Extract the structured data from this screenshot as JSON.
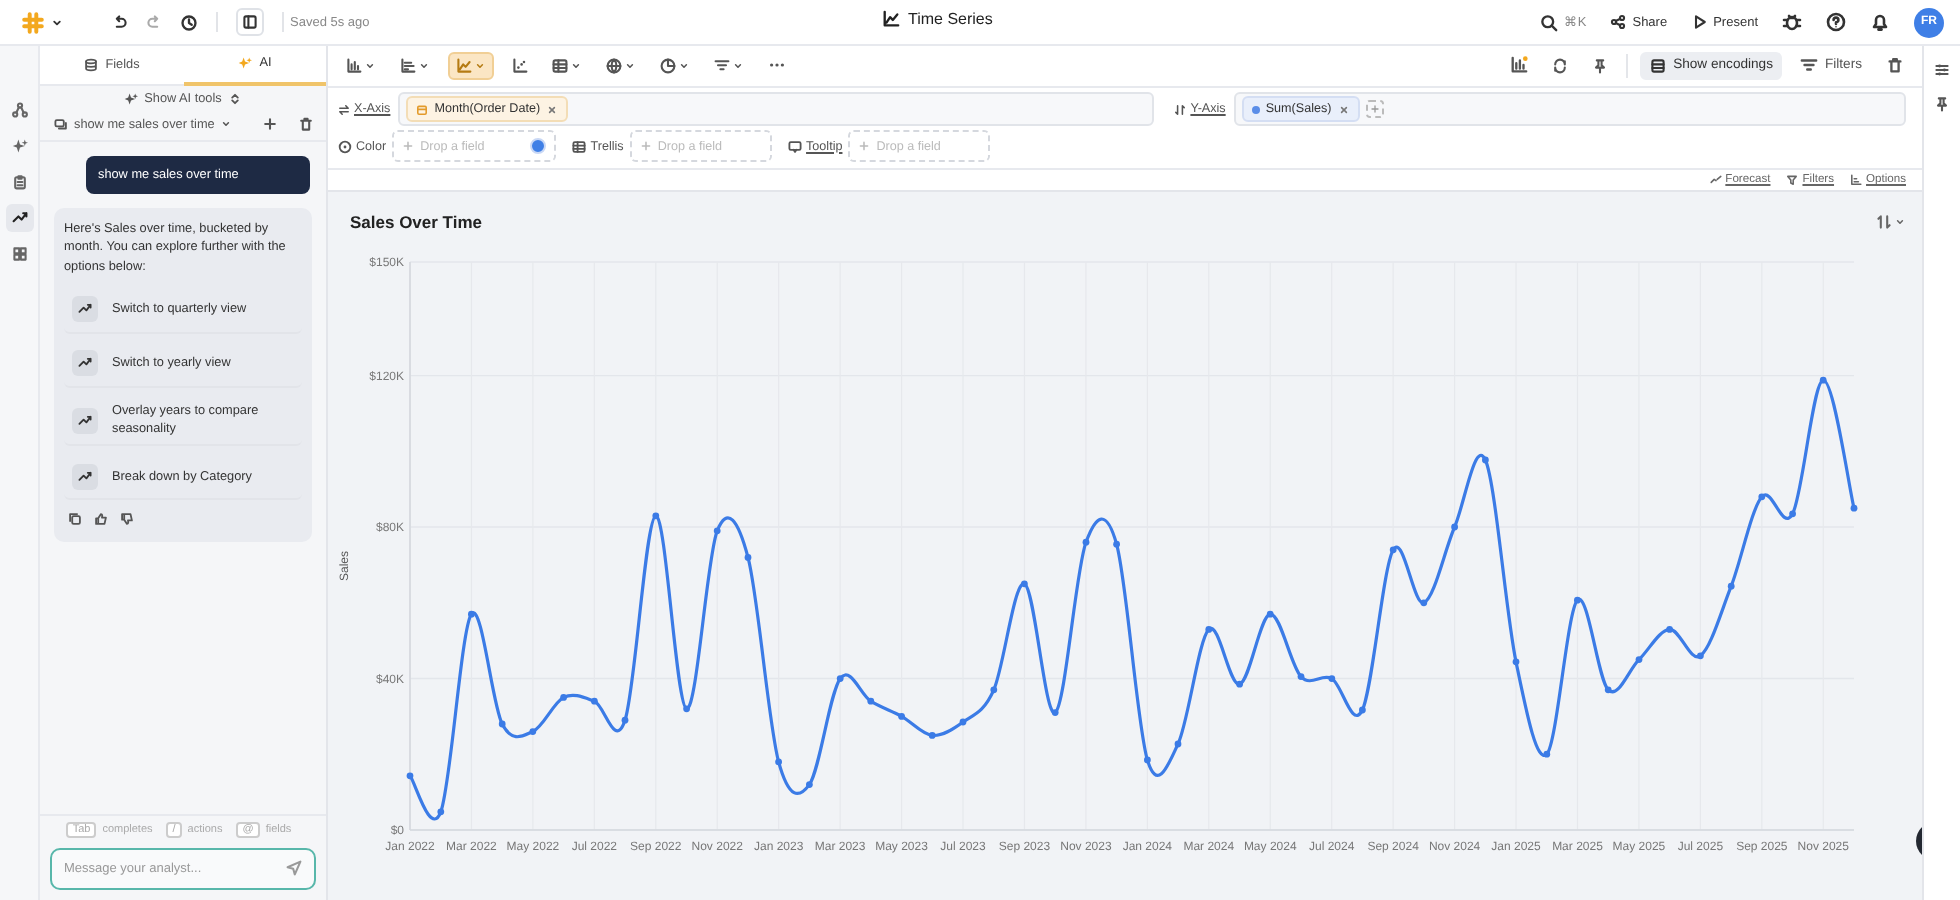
{
  "app": {
    "saved_status": "Saved 5s ago",
    "title": "Time Series",
    "search_shortcut": "⌘K",
    "share": "Share",
    "present": "Present",
    "avatar": "FR"
  },
  "rail": {
    "items": [
      {
        "selected": false
      },
      {
        "selected": false
      },
      {
        "selected": false
      },
      {
        "selected": true
      },
      {
        "selected": false
      }
    ]
  },
  "sidebar": {
    "tabs": [
      {
        "label": "Fields",
        "selected": false
      },
      {
        "label": "AI",
        "selected": true
      }
    ],
    "ai_tools": "Show AI tools",
    "conversation": "show me sales over time",
    "user_message": "show me sales over time",
    "reply": "Here's Sales over time, bucketed by month. You can explore further with the options below:",
    "suggestions": [
      "Switch to quarterly view",
      "Switch to yearly view",
      "Overlay years to compare seasonality",
      "Break down by Category"
    ],
    "hints": [
      {
        "key": "Tab",
        "label": "completes"
      },
      {
        "key": "/",
        "label": "actions"
      },
      {
        "key": "@",
        "label": "fields"
      }
    ],
    "message_placeholder": "Message your analyst..."
  },
  "toolbar": {
    "chart_types": [
      {
        "selected": false
      },
      {
        "selected": false
      },
      {
        "selected": true
      },
      {
        "selected": false
      },
      {
        "selected": false
      },
      {
        "selected": false
      },
      {
        "selected": false
      },
      {
        "selected": false
      }
    ],
    "show_encodings": "Show encodings",
    "filters": "Filters"
  },
  "encodings": {
    "x_axis": {
      "label": "X-Axis",
      "pills": [
        "Month(Order Date)"
      ]
    },
    "y_axis": {
      "label": "Y-Axis",
      "pills": [
        "Sum(Sales)"
      ]
    },
    "slots": [
      {
        "label": "Color",
        "placeholder": "Drop a field"
      },
      {
        "label": "Trellis",
        "placeholder": "Drop a field"
      },
      {
        "label": "Tooltip",
        "placeholder": "Drop a field"
      }
    ]
  },
  "chart_links": [
    "Forecast",
    "Filters",
    "Options"
  ],
  "chart": {
    "title": "Sales Over Time",
    "chart_data": {
      "type": "line",
      "ylabel": "Sales",
      "categories": [
        "Jan 2022",
        null,
        "Mar 2022",
        null,
        "May 2022",
        null,
        "Jul 2022",
        null,
        "Sep 2022",
        null,
        "Nov 2022",
        null,
        "Jan 2023",
        null,
        "Mar 2023",
        null,
        "May 2023",
        null,
        "Jul 2023",
        null,
        "Sep 2023",
        null,
        "Nov 2023",
        null,
        "Jan 2024",
        null,
        "Mar 2024",
        null,
        "May 2024",
        null,
        "Jul 2024",
        null,
        "Sep 2024",
        null,
        "Nov 2024",
        null,
        "Jan 2025",
        null,
        "Mar 2025",
        null,
        "May 2025",
        null,
        "Jul 2025",
        null,
        "Sep 2025",
        null,
        "Nov 2025",
        null
      ],
      "grid": true,
      "series": [
        {
          "color": "#3b7be6",
          "marker": true,
          "values": [
            14300,
            4800,
            57000,
            28000,
            26000,
            35000,
            34000,
            29000,
            83000,
            32000,
            79000,
            72000,
            18000,
            12000,
            40000,
            34000,
            30000,
            25000,
            28500,
            37000,
            65000,
            31000,
            76000,
            75500,
            18500,
            22700,
            53000,
            38500,
            57000,
            40500,
            40000,
            31700,
            74000,
            60000,
            80000,
            97700,
            44400,
            20000,
            60700,
            37000,
            45000,
            53000,
            46000,
            64400,
            88000,
            83500,
            118800,
            85000
          ]
        }
      ],
      "ylim": [
        0,
        150000
      ],
      "yticks": [
        {
          "value": 0,
          "label": "$0"
        },
        {
          "value": 40000,
          "label": "$40K"
        },
        {
          "value": 80000,
          "label": "$80K"
        },
        {
          "value": 120000,
          "label": "$120K"
        },
        {
          "value": 150000,
          "label": "$150K"
        }
      ]
    }
  }
}
